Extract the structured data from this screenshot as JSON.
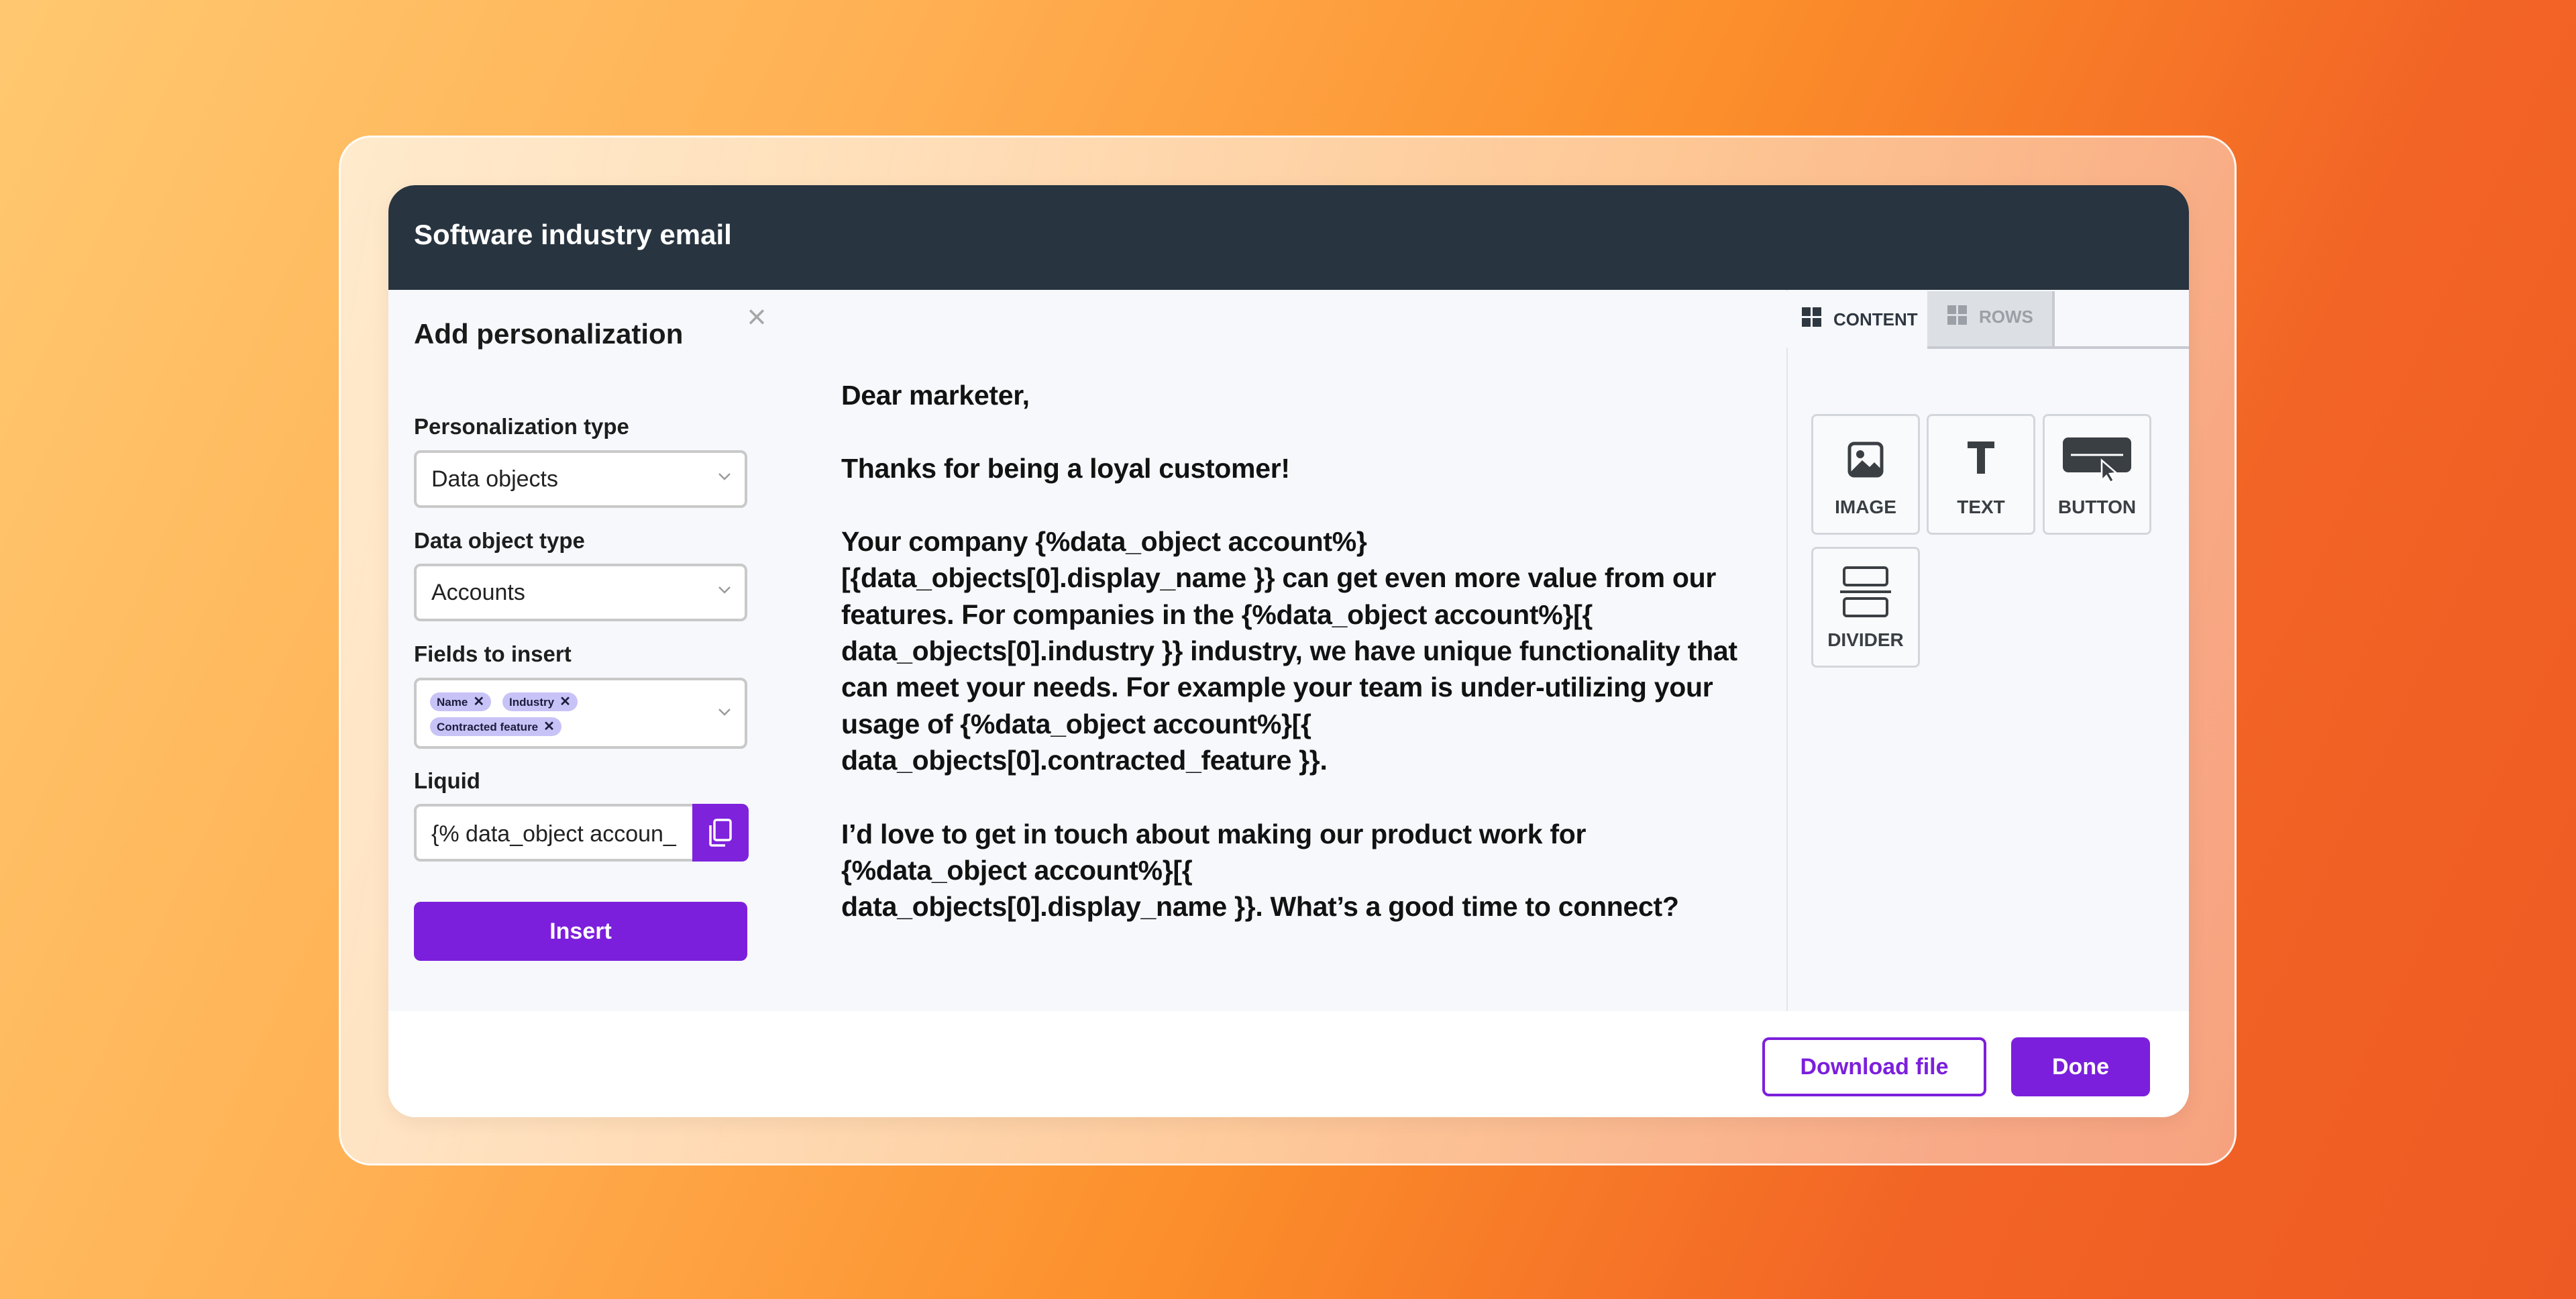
{
  "window": {
    "title": "Software industry email"
  },
  "panel": {
    "title": "Add personalization",
    "personalization_type": {
      "label": "Personalization type",
      "value": "Data objects"
    },
    "data_object_type": {
      "label": "Data object type",
      "value": "Accounts"
    },
    "fields_to_insert": {
      "label": "Fields to insert",
      "tags": [
        "Name",
        "Industry",
        "Contracted feature"
      ]
    },
    "liquid": {
      "label": "Liquid",
      "value": "{% data_object accoun_"
    },
    "insert_label": "Insert"
  },
  "email": {
    "lines": [
      "Dear marketer,",
      "Thanks for being a loyal customer!",
      "Your company {%data_object account%}",
      "[{data_objects[0].display_name }} can get even more value from our",
      "features. For companies in the {%data_object account%}[{",
      "data_objects[0].industry }} industry, we have unique functionality that",
      "can meet your needs. For example your team is under-utilizing your",
      "usage of {%data_object account%}[{",
      "data_objects[0].contracted_feature }}.",
      "I’d love to get in touch about making our product work for",
      "{%data_object account%}[{",
      "data_objects[0].display_name }}. What’s a good time to connect?"
    ]
  },
  "sidebar": {
    "tabs": [
      {
        "label": "CONTENT",
        "icon": "grid-icon",
        "active": true
      },
      {
        "label": "ROWS",
        "icon": "grid-icon",
        "active": false
      }
    ],
    "tiles": [
      {
        "label": "IMAGE",
        "icon": "image-icon"
      },
      {
        "label": "TEXT",
        "icon": "text-icon"
      },
      {
        "label": "BUTTON",
        "icon": "button-icon"
      },
      {
        "label": "DIVIDER",
        "icon": "divider-icon"
      }
    ]
  },
  "footer": {
    "download_label": "Download file",
    "done_label": "Done"
  },
  "colors": {
    "accent": "#7c1fdc",
    "header": "#28343f",
    "tag": "#c7c3f7"
  }
}
